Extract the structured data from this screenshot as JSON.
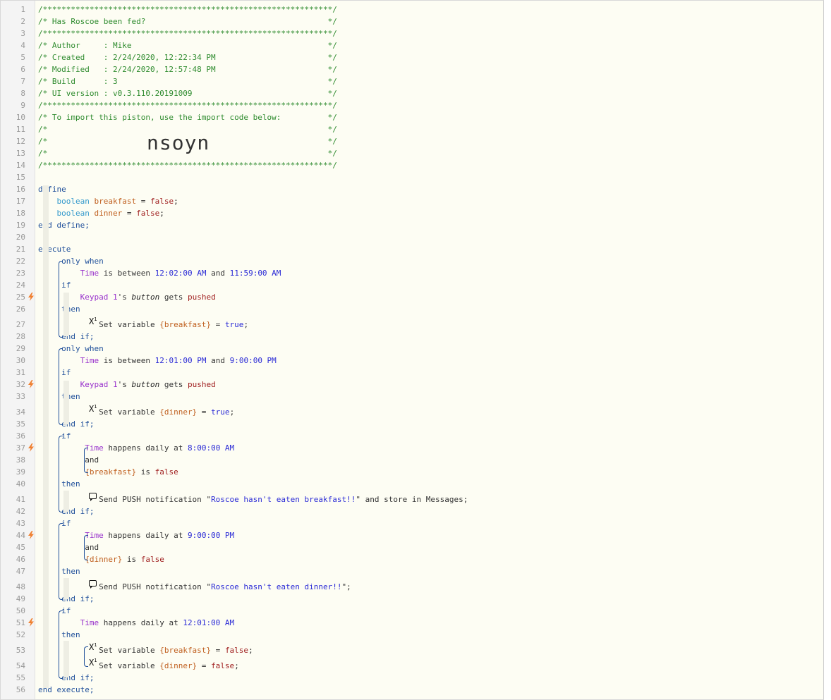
{
  "lines": {
    "l1": "/**************************************************************/",
    "l2": "/* Has Roscoe been fed?                                       */",
    "l3": "/**************************************************************/",
    "l4": "/* Author     : Mike                                          */",
    "l5": "/* Created    : 2/24/2020, 12:22:34 PM                        */",
    "l6": "/* Modified   : 2/24/2020, 12:57:48 PM                        */",
    "l7": "/* Build      : 3                                             */",
    "l8": "/* UI version : v0.3.110.20191009                             */",
    "l9": "/**************************************************************/",
    "l10": "/* To import this piston, use the import code below:          */",
    "l11": "/*                                                            */",
    "l12": "/*                                                            */",
    "l13": "/*                                                            */",
    "l14": "/**************************************************************/"
  },
  "import_code": "nsoyn",
  "kw": {
    "define": "define",
    "boolean": "boolean",
    "end_define": "end define;",
    "execute": "execute",
    "only_when": "only when",
    "if": "if",
    "then": "then",
    "end_if": "end if;",
    "and": "and",
    "end_execute": "end execute;"
  },
  "vars": {
    "breakfast": "breakfast",
    "dinner": "dinner",
    "breakfast_ref": "{breakfast}",
    "dinner_ref": "{dinner}"
  },
  "vals": {
    "false": "false",
    "true": "true",
    "t1a": "12:02:00 AM",
    "t1b": "11:59:00 AM",
    "t2a": "12:01:00 PM",
    "t2b": "9:00:00 PM",
    "t3": "8:00:00 AM",
    "t4": "9:00:00 PM",
    "t5": "12:01:00 AM",
    "msg1": "Roscoe hasn't eaten breakfast!!",
    "msg2": "Roscoe hasn't eaten dinner!!"
  },
  "words": {
    "time": "Time",
    "is_between": " is between ",
    "and_sp": " and ",
    "keypad": "Keypad 1",
    "s_": "'s ",
    "button": "button",
    "gets": " gets ",
    "pushed": "pushed",
    "set_variable": " Set variable ",
    "eq": " = ",
    "semi": ";",
    "happens_daily_at": " happens daily at ",
    "is_": " is ",
    "send_push": " Send PUSH notification ",
    "q": "\"",
    "store": " and store in Messages;",
    "end_semi": "\";",
    "eq_sp": " = "
  },
  "icons": {
    "flash": "lightning-bolt-icon",
    "variable": "variable-x-icon",
    "message": "speech-bubble-icon"
  },
  "colors": {
    "comment": "#2e8b2e",
    "keyword": "#1f4f9a",
    "type": "#3399cc",
    "variable": "#c06020",
    "boolean_value": "#a02020",
    "value": "#2b2bd6",
    "device": "#9932cc",
    "flash": "#f08030"
  },
  "line_numbers": [
    "1",
    "2",
    "3",
    "4",
    "5",
    "6",
    "7",
    "8",
    "9",
    "10",
    "11",
    "12",
    "13",
    "14",
    "15",
    "16",
    "17",
    "18",
    "19",
    "20",
    "21",
    "22",
    "23",
    "24",
    "25",
    "26",
    "27",
    "28",
    "29",
    "30",
    "31",
    "32",
    "33",
    "34",
    "35",
    "36",
    "37",
    "38",
    "39",
    "40",
    "41",
    "42",
    "43",
    "44",
    "45",
    "46",
    "47",
    "48",
    "49",
    "50",
    "51",
    "52",
    "53",
    "54",
    "55",
    "56"
  ]
}
